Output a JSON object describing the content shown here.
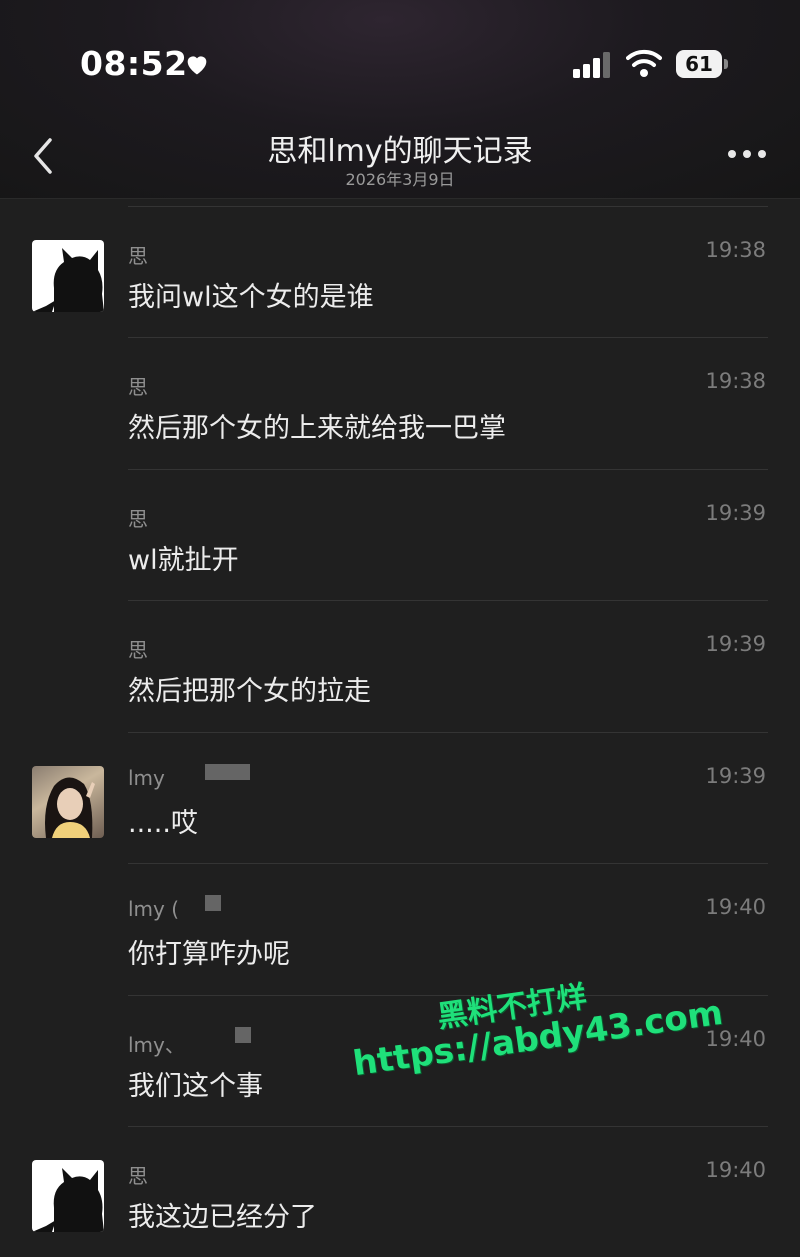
{
  "status": {
    "time": "08:52",
    "battery": "61"
  },
  "header": {
    "title": "思和lmy的聊天记录",
    "subtitle": "2026年3月9日"
  },
  "messages": [
    {
      "sender": "思",
      "time": "19:38",
      "text": "我问wl这个女的是谁",
      "avatar": "cat"
    },
    {
      "sender": "思",
      "time": "19:38",
      "text": "然后那个女的上来就给我一巴掌",
      "avatar": ""
    },
    {
      "sender": "思",
      "time": "19:39",
      "text": "wl就扯开",
      "avatar": ""
    },
    {
      "sender": "思",
      "time": "19:39",
      "text": "然后把那个女的拉走",
      "avatar": ""
    },
    {
      "sender": "lmy",
      "time": "19:39",
      "text": ".....哎",
      "avatar": "girl"
    },
    {
      "sender": "lmy (",
      "time": "19:40",
      "text": "你打算咋办呢",
      "avatar": ""
    },
    {
      "sender": "lmy、",
      "time": "19:40",
      "text": "我们这个事",
      "avatar": ""
    },
    {
      "sender": "思",
      "time": "19:40",
      "text": "我这边已经分了",
      "avatar": "cat"
    }
  ],
  "watermark": {
    "line1": "黑料不打烊",
    "line2": "https://abdy43.com"
  },
  "colors": {
    "background": "#1f1f1f",
    "watermark": "#1fe07a"
  }
}
